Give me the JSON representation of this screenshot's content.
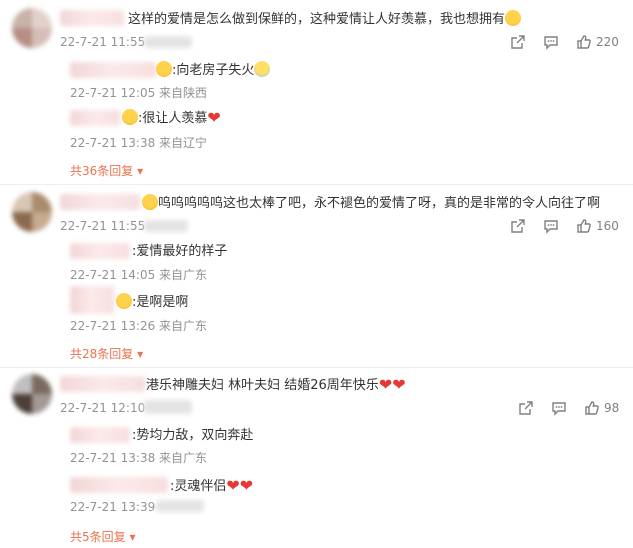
{
  "comments": [
    {
      "text_pre": "这样的爱情是怎么做到保鲜的，这种爱情让人好羡慕，我也想拥有",
      "timestamp": "22-7-21 11:55",
      "likes": "220",
      "replies": [
        {
          "text": ":向老房子失火",
          "meta": "22-7-21 12:05 来自陕西"
        },
        {
          "text": ":很让人羡慕",
          "meta": "22-7-21 13:38 来自辽宁"
        }
      ],
      "more": "共36条回复"
    },
    {
      "text_pre": "呜呜呜呜呜这也太棒了吧，永不褪色的爱情了呀，真的是非常的令人向往了啊",
      "timestamp": "22-7-21 11:55",
      "likes": "160",
      "replies": [
        {
          "text": ":爱情最好的样子",
          "meta": "22-7-21 14:05 来自广东"
        },
        {
          "text": ":是啊是啊",
          "meta": "22-7-21 13:26 来自广东"
        }
      ],
      "more": "共28条回复"
    },
    {
      "text_pre": "港乐神雕夫妇 林叶夫妇 结婚26周年快乐",
      "timestamp": "22-7-21 12:10",
      "likes": "98",
      "replies": [
        {
          "text": ":势均力敌，双向奔赴",
          "meta": "22-7-21 13:38 来自广东"
        },
        {
          "text": ":灵魂伴侣",
          "meta": "22-7-21 13:39"
        }
      ],
      "more": "共5条回复"
    }
  ],
  "colors": {
    "accent": "#eb7350",
    "heart": "#e53935",
    "meta": "#939393"
  }
}
